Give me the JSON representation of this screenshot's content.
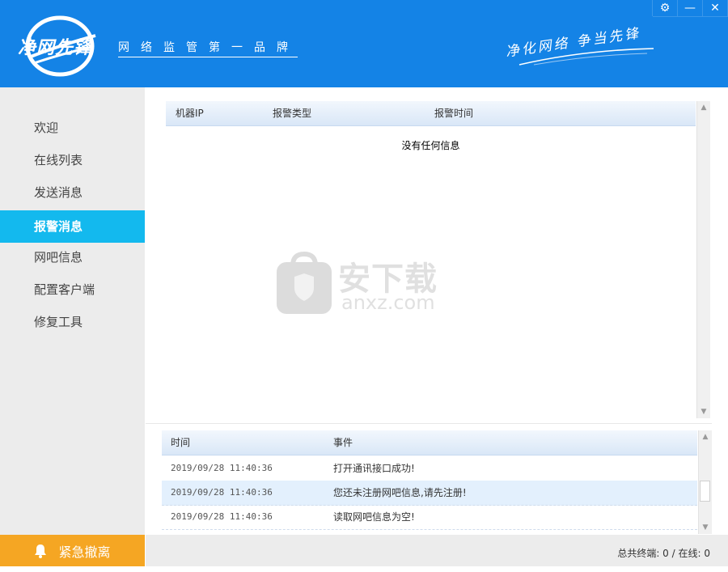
{
  "window": {
    "controls": [
      {
        "name": "settings",
        "glyph": "⚙"
      },
      {
        "name": "minimize",
        "glyph": "—"
      },
      {
        "name": "close",
        "glyph": "✕"
      }
    ]
  },
  "header": {
    "brand": "净网先锋",
    "tagline": "网络监管第一品牌",
    "slogan": "净化网络 争当先锋",
    "bg_color": "#1483e6"
  },
  "sidebar": {
    "items": [
      {
        "label": "欢迎",
        "active": false
      },
      {
        "label": "在线列表",
        "active": false
      },
      {
        "label": "发送消息",
        "active": false
      },
      {
        "label": "报警消息",
        "active": true
      },
      {
        "label": "网吧信息",
        "active": false
      },
      {
        "label": "配置客户端",
        "active": false
      },
      {
        "label": "修复工具",
        "active": false
      }
    ],
    "active_color": "#13b9ee",
    "emergency_label": "紧急撤离",
    "emergency_color": "#f5a623"
  },
  "alarm_table": {
    "columns": [
      "机器IP",
      "报警类型",
      "报警时间"
    ],
    "empty_message": "没有任何信息"
  },
  "log_table": {
    "columns": [
      "时间",
      "事件"
    ],
    "rows": [
      {
        "time": "2019/09/28 11:40:36",
        "event": "打开通讯接口成功!",
        "selected": false
      },
      {
        "time": "2019/09/28 11:40:36",
        "event": "您还未注册网吧信息,请先注册!",
        "selected": true
      },
      {
        "time": "2019/09/28 11:40:36",
        "event": "读取网吧信息为空!",
        "selected": false
      }
    ]
  },
  "status": {
    "text": "总共终端: 0 / 在线: 0"
  },
  "watermark": {
    "cn": "安下载",
    "en": "anxz.com"
  }
}
